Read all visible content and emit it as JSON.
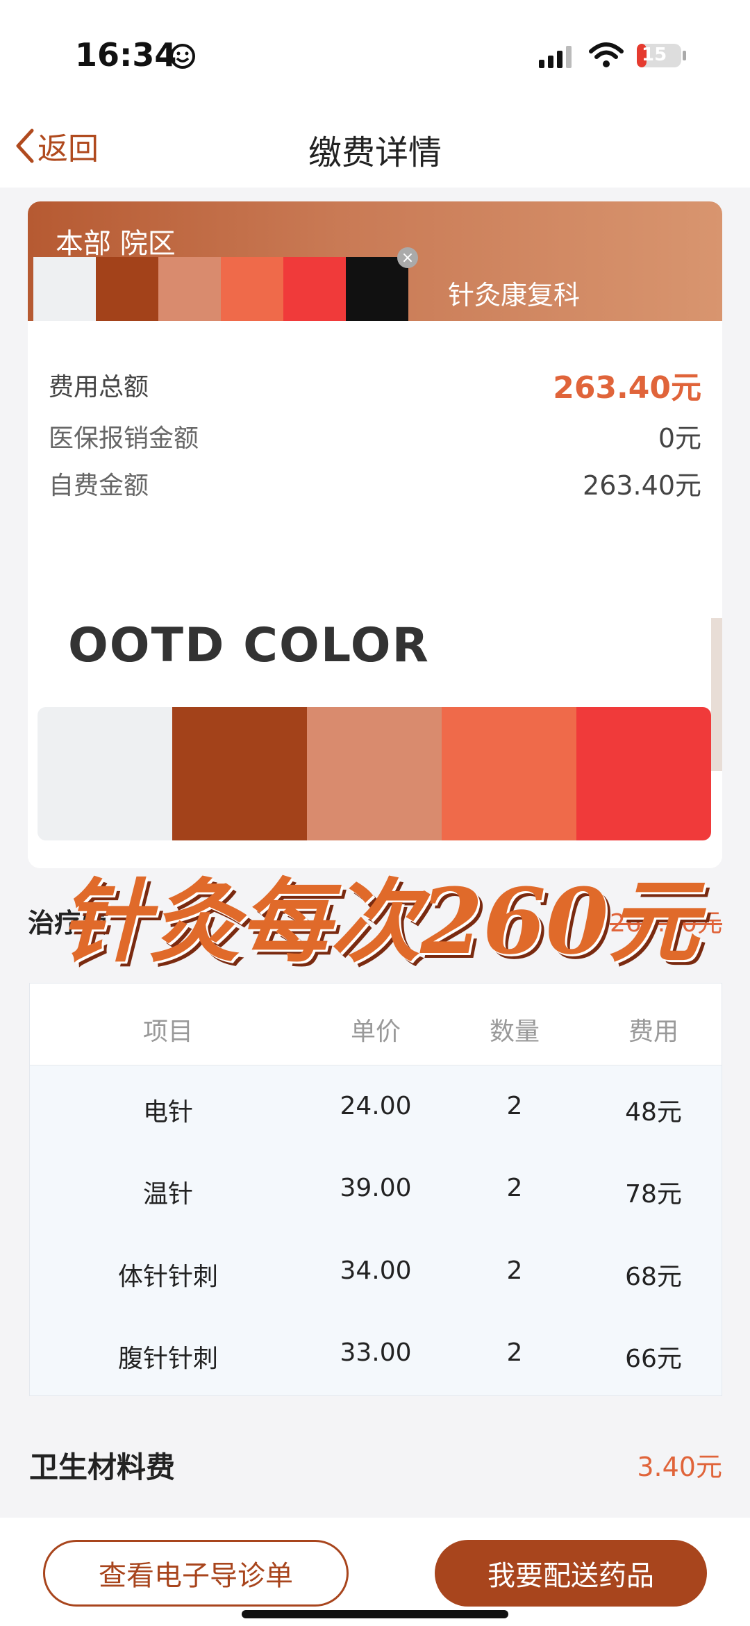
{
  "status_bar": {
    "time": "16:34",
    "battery": "15",
    "icons": [
      "smile-icon",
      "signal-icon",
      "wifi-icon",
      "battery-charging-icon"
    ]
  },
  "nav": {
    "back_label": "返回",
    "title": "缴费详情"
  },
  "card": {
    "campus": "本部 院区",
    "department": "针灸康复科",
    "header_swatches": [
      "#eef0f2",
      "#a3421a",
      "#d98b6e",
      "#ef6a4a",
      "#f03a3a",
      "#111111"
    ]
  },
  "summary": {
    "total_label": "费用总额",
    "total_value": "263.40元",
    "insurance_label": "医保报销金额",
    "insurance_value": "0元",
    "self_label": "自费金额",
    "self_value": "263.40元"
  },
  "ootd": {
    "title": "OOTD COLOR",
    "swatches": [
      "#eef0f2",
      "#a3421a",
      "#d98b6e",
      "#ef6a4a",
      "#f03a3a"
    ]
  },
  "treatment": {
    "label": "治疗费",
    "amount": "260.00元"
  },
  "promo": {
    "text": "针灸每次260元"
  },
  "table": {
    "headers": [
      "项目",
      "单价",
      "数量",
      "费用"
    ],
    "rows": [
      {
        "item": "电针",
        "price": "24.00",
        "qty": "2",
        "cost": "48元"
      },
      {
        "item": "温针",
        "price": "39.00",
        "qty": "2",
        "cost": "78元"
      },
      {
        "item": "体针针刺",
        "price": "34.00",
        "qty": "2",
        "cost": "68元"
      },
      {
        "item": "腹针针刺",
        "price": "33.00",
        "qty": "2",
        "cost": "66元"
      }
    ]
  },
  "material": {
    "label": "卫生材料费",
    "value": "3.40元"
  },
  "bottom": {
    "guide_label": "查看电子导诊单",
    "deliver_label": "我要配送药品"
  },
  "colors": {
    "accent": "#a8451d",
    "price": "#e0643a"
  }
}
